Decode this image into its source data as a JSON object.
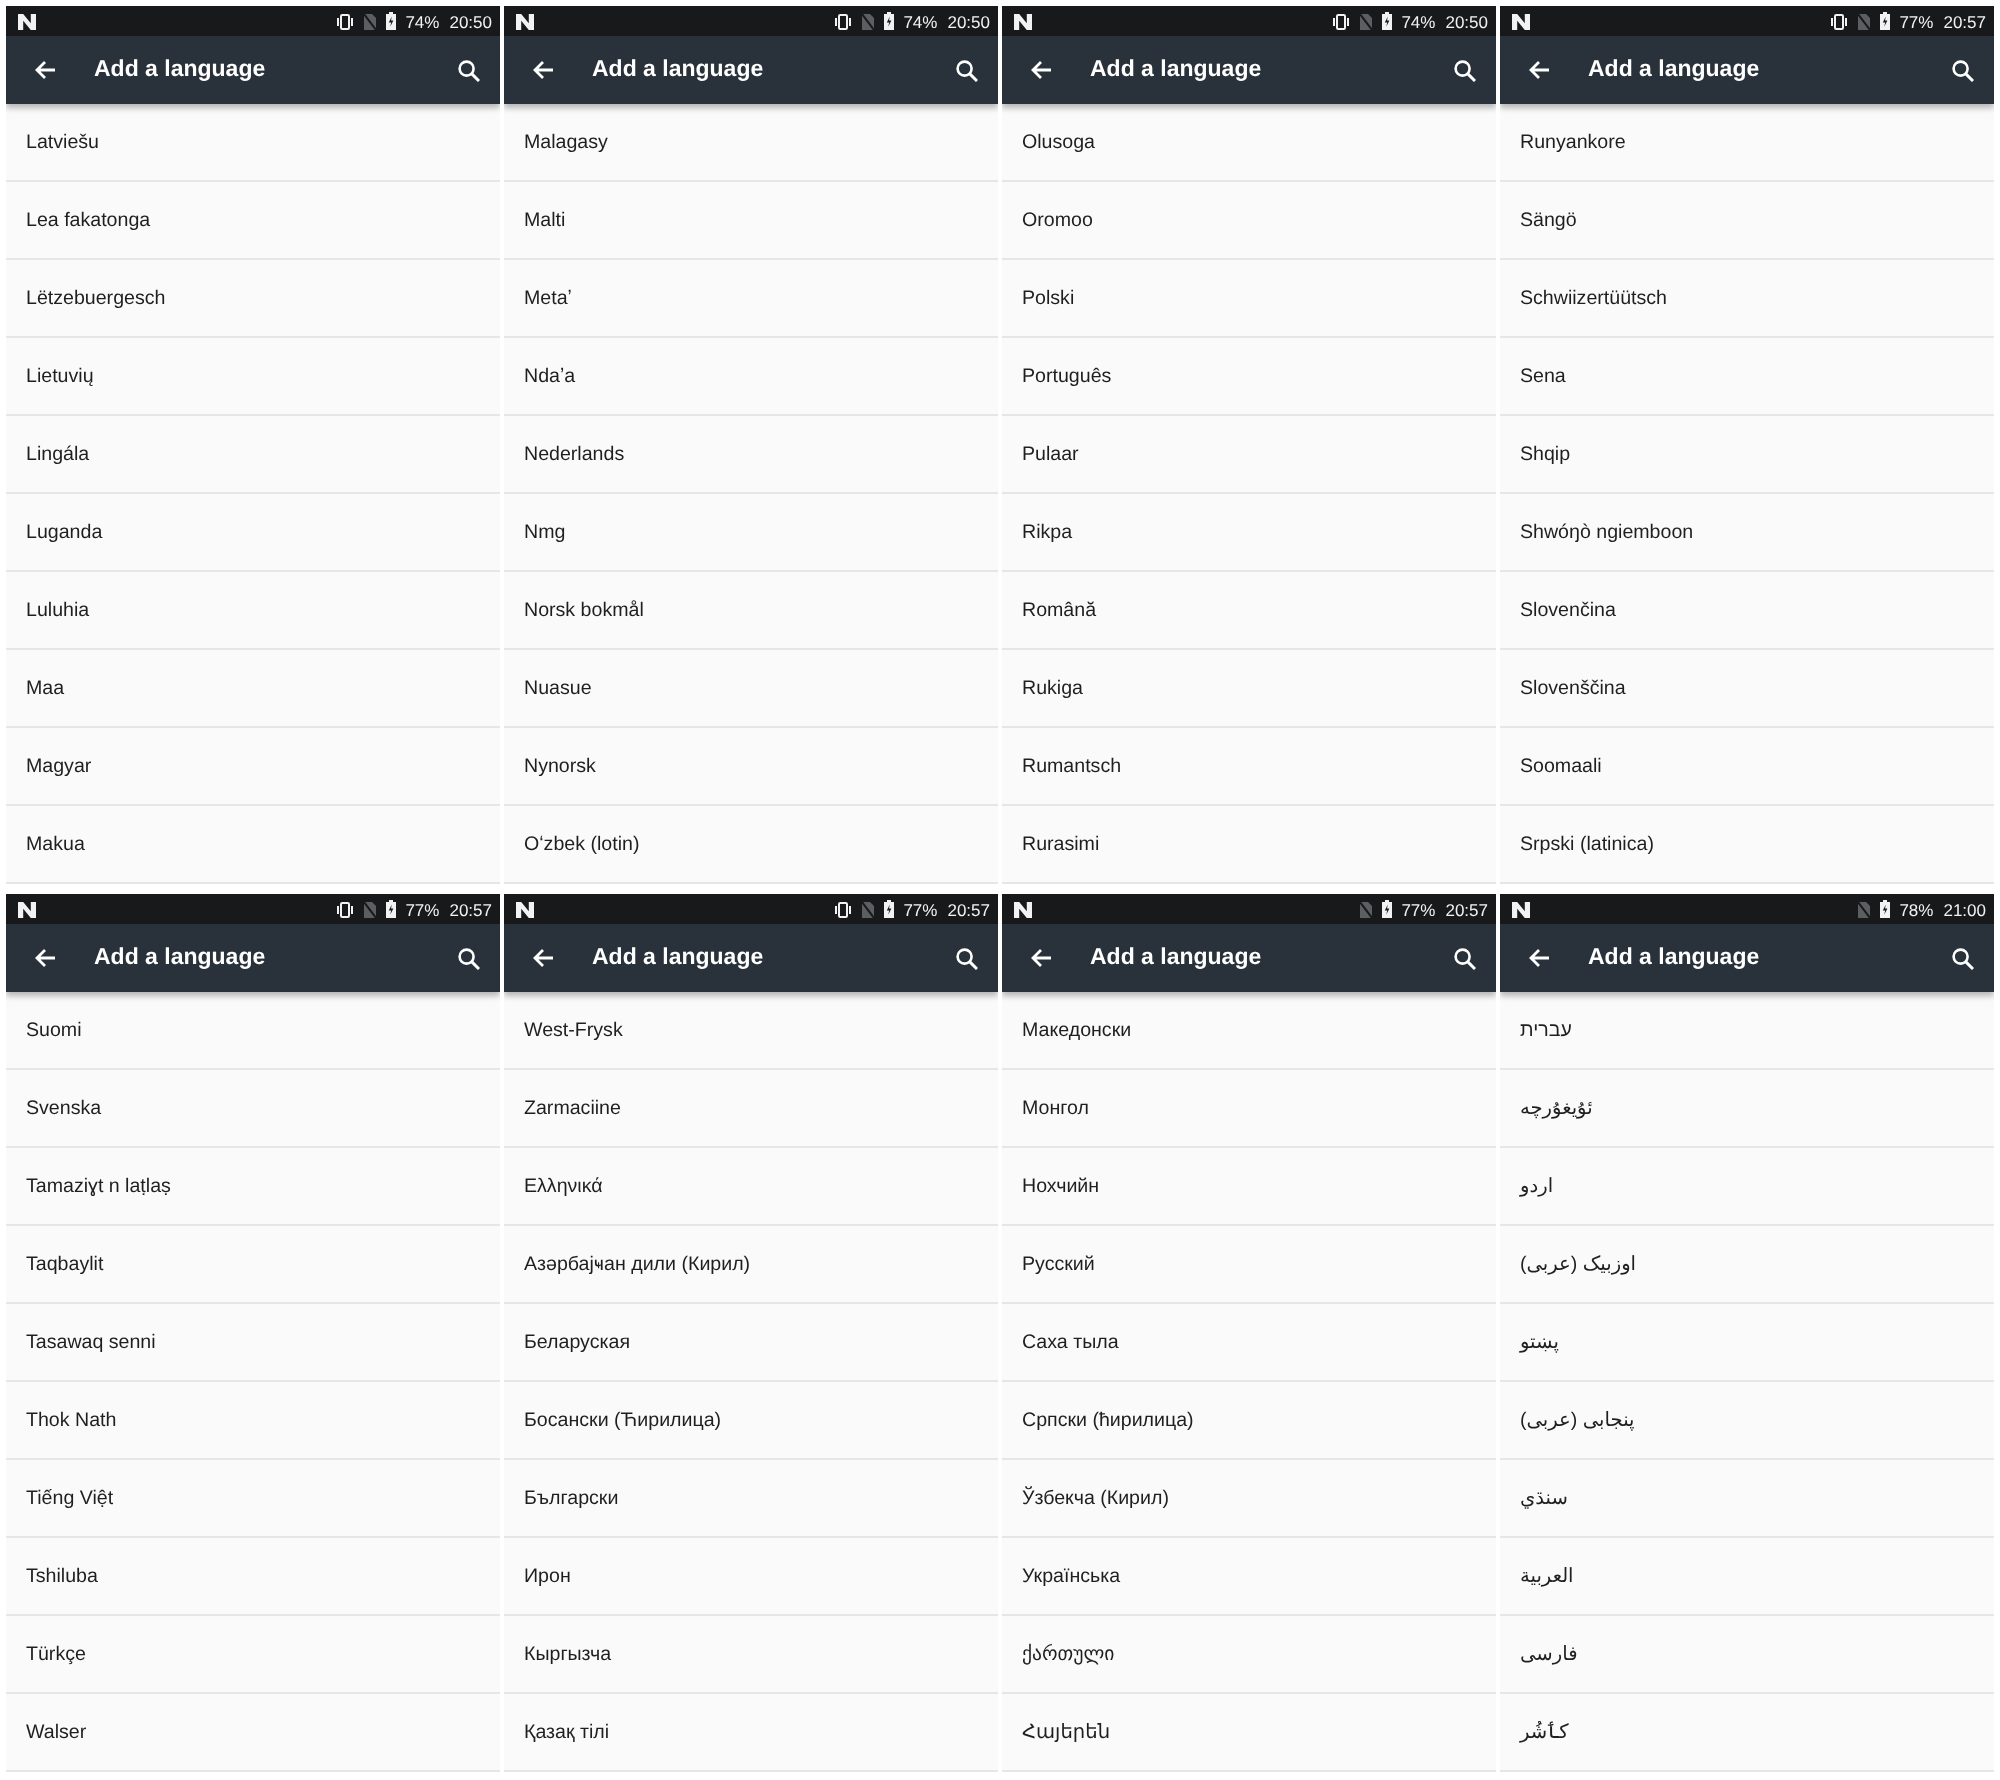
{
  "panels": [
    {
      "status_bar": {
        "vibrate": true,
        "battery": "74%",
        "time": "20:50"
      },
      "app_bar": {
        "title": "Add a language"
      },
      "languages": [
        "Latviešu",
        "Lea fakatonga",
        "Lëtzebuergesch",
        "Lietuvių",
        "Lingála",
        "Luganda",
        "Luluhia",
        "Maa",
        "Magyar",
        "Makua"
      ]
    },
    {
      "status_bar": {
        "vibrate": true,
        "battery": "74%",
        "time": "20:50"
      },
      "app_bar": {
        "title": "Add a language"
      },
      "languages": [
        "Malagasy",
        "Malti",
        "Metaʼ",
        "Ndaʼa",
        "Nederlands",
        "Nmg",
        "Norsk bokmål",
        "Nuasue",
        "Nynorsk",
        "Oʻzbek (lotin)"
      ]
    },
    {
      "status_bar": {
        "vibrate": true,
        "battery": "74%",
        "time": "20:50"
      },
      "app_bar": {
        "title": "Add a language"
      },
      "languages": [
        "Olusoga",
        "Oromoo",
        "Polski",
        "Português",
        "Pulaar",
        "Rikpa",
        "Română",
        "Rukiga",
        "Rumantsch",
        "Rurasimi"
      ]
    },
    {
      "status_bar": {
        "vibrate": true,
        "battery": "77%",
        "time": "20:57"
      },
      "app_bar": {
        "title": "Add a language"
      },
      "languages": [
        "Runyankore",
        "Sängö",
        "Schwiizertüütsch",
        "Sena",
        "Shqip",
        "Shwóŋò ngiemboon",
        "Slovenčina",
        "Slovenščina",
        "Soomaali",
        "Srpski (latinica)"
      ]
    },
    {
      "status_bar": {
        "vibrate": true,
        "battery": "77%",
        "time": "20:57"
      },
      "app_bar": {
        "title": "Add a language"
      },
      "languages": [
        "Suomi",
        "Svenska",
        "Tamaziɣt n laṭlaṣ",
        "Taqbaylit",
        "Tasawaq senni",
        "Thok Nath",
        "Tiếng Việt",
        "Tshiluba",
        "Türkçe",
        "Walser"
      ]
    },
    {
      "status_bar": {
        "vibrate": true,
        "battery": "77%",
        "time": "20:57"
      },
      "app_bar": {
        "title": "Add a language"
      },
      "languages": [
        "West-Frysk",
        "Zarmaciine",
        "Ελληνικά",
        "Азәрбајҹан дили (Кирил)",
        "Беларуская",
        "Босански (Ћирилица)",
        "Български",
        "Ирон",
        "Кыргызча",
        "Қазақ тілі"
      ]
    },
    {
      "status_bar": {
        "vibrate": false,
        "battery": "77%",
        "time": "20:57"
      },
      "app_bar": {
        "title": "Add a language"
      },
      "languages": [
        "Македонски",
        "Монгол",
        "Нохчийн",
        "Русский",
        "Саха тыла",
        "Српски (ћирилица)",
        "Ўзбекча (Кирил)",
        "Українська",
        "ქართული",
        "Հայերեն"
      ]
    },
    {
      "status_bar": {
        "vibrate": false,
        "battery": "78%",
        "time": "21:00"
      },
      "app_bar": {
        "title": "Add a language"
      },
      "languages": [
        "עברית",
        "ئۇيغۇرچە",
        "اردو",
        "اوزبیک (عربی)",
        "پښتو",
        "پنجابی (عربی)",
        "سنڌي",
        "العربية",
        "فارسی",
        "کٲشُر"
      ]
    }
  ]
}
